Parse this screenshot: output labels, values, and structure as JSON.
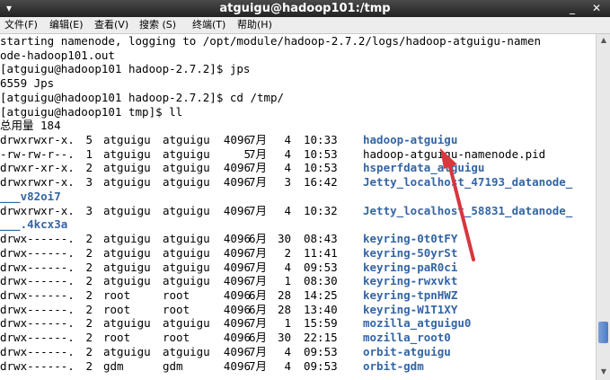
{
  "window": {
    "title": "atguigu@hadoop101:/tmp"
  },
  "menu": [
    "文件(F)",
    "编辑(E)",
    "查看(V)",
    "搜索 (S)",
    "终端(T)",
    "帮助(H)"
  ],
  "colors": {
    "link": "#3465a4",
    "arrow": "#d9363e"
  },
  "icons": {
    "window_menu": "window-menu-icon",
    "minimize": "minimize-icon",
    "close": "close-icon"
  },
  "terminal": {
    "pre": [
      "starting namenode, logging to /opt/module/hadoop-2.7.2/logs/hadoop-atguigu-namen",
      "ode-hadoop101.out",
      "[atguigu@hadoop101 hadoop-2.7.2]$ jps",
      "6559 Jps",
      "[atguigu@hadoop101 hadoop-2.7.2]$ cd /tmp/",
      "[atguigu@hadoop101 tmp]$ ll",
      "总用量 184"
    ],
    "entries": [
      {
        "perm": "drwxrwxr-x.",
        "links": "5",
        "user": "atguigu",
        "group": "atguigu",
        "size": "4096",
        "month": "7月",
        "day": "4",
        "time": "10:33",
        "name": "hadoop-atguigu",
        "dir": true
      },
      {
        "perm": "-rw-rw-r--.",
        "links": "1",
        "user": "atguigu",
        "group": "atguigu",
        "size": "5",
        "month": "7月",
        "day": "4",
        "time": "10:53",
        "name": "hadoop-atguigu-namenode.pid",
        "dir": false
      },
      {
        "perm": "drwxr-xr-x.",
        "links": "2",
        "user": "atguigu",
        "group": "atguigu",
        "size": "4096",
        "month": "7月",
        "day": "4",
        "time": "10:53",
        "name": "hsperfdata_atguigu",
        "dir": true
      },
      {
        "perm": "drwxrwxr-x.",
        "links": "3",
        "user": "atguigu",
        "group": "atguigu",
        "size": "4096",
        "month": "7月",
        "day": "3",
        "time": "16:42",
        "name": "Jetty_localhost_47193_datanode_",
        "name2": "___v82oi7",
        "dir": true
      },
      {
        "perm": "drwxrwxr-x.",
        "links": "3",
        "user": "atguigu",
        "group": "atguigu",
        "size": "4096",
        "month": "7月",
        "day": "4",
        "time": "10:32",
        "name": "Jetty_localhost_58831_datanode_",
        "name2": "___.4kcx3a",
        "dir": true
      },
      {
        "perm": "drwx------.",
        "links": "2",
        "user": "atguigu",
        "group": "atguigu",
        "size": "4096",
        "month": "6月",
        "day": "30",
        "time": "08:43",
        "name": "keyring-0t0tFY",
        "dir": true
      },
      {
        "perm": "drwx------.",
        "links": "2",
        "user": "atguigu",
        "group": "atguigu",
        "size": "4096",
        "month": "7月",
        "day": "2",
        "time": "11:41",
        "name": "keyring-50yrSt",
        "dir": true
      },
      {
        "perm": "drwx------.",
        "links": "2",
        "user": "atguigu",
        "group": "atguigu",
        "size": "4096",
        "month": "7月",
        "day": "4",
        "time": "09:53",
        "name": "keyring-paR0ci",
        "dir": true
      },
      {
        "perm": "drwx------.",
        "links": "2",
        "user": "atguigu",
        "group": "atguigu",
        "size": "4096",
        "month": "7月",
        "day": "1",
        "time": "08:30",
        "name": "keyring-rwxvkt",
        "dir": true
      },
      {
        "perm": "drwx------.",
        "links": "2",
        "user": "root",
        "group": "root",
        "size": "4096",
        "month": "6月",
        "day": "28",
        "time": "14:25",
        "name": "keyring-tpnHWZ",
        "dir": true
      },
      {
        "perm": "drwx------.",
        "links": "2",
        "user": "root",
        "group": "root",
        "size": "4096",
        "month": "6月",
        "day": "28",
        "time": "13:40",
        "name": "keyring-W1T1XY",
        "dir": true
      },
      {
        "perm": "drwx------.",
        "links": "2",
        "user": "atguigu",
        "group": "atguigu",
        "size": "4096",
        "month": "7月",
        "day": "1",
        "time": "15:59",
        "name": "mozilla_atguigu0",
        "dir": true
      },
      {
        "perm": "drwx------.",
        "links": "2",
        "user": "root",
        "group": "root",
        "size": "4096",
        "month": "6月",
        "day": "30",
        "time": "22:15",
        "name": "mozilla_root0",
        "dir": true
      },
      {
        "perm": "drwx------.",
        "links": "2",
        "user": "atguigu",
        "group": "atguigu",
        "size": "4096",
        "month": "7月",
        "day": "4",
        "time": "09:53",
        "name": "orbit-atguigu",
        "dir": true
      },
      {
        "perm": "drwx------.",
        "links": "2",
        "user": "gdm",
        "group": "gdm",
        "size": "4096",
        "month": "7月",
        "day": "4",
        "time": "09:53",
        "name": "orbit-gdm",
        "dir": true
      }
    ]
  }
}
